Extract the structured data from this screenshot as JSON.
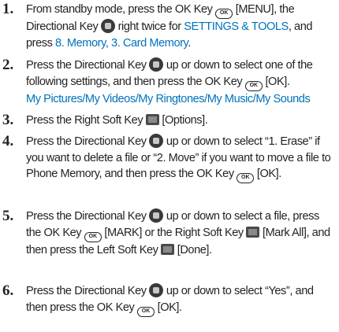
{
  "steps": [
    {
      "number": "1",
      "t1": "From standby mode, press the OK Key",
      "t2": "[MENU], the Directional Key",
      "t3": "right twice for",
      "h1": "SETTINGS & TOOLS",
      "t4": ", and press",
      "h2": "8. Memory, 3. Card Memory",
      "t5": "."
    },
    {
      "number": "2",
      "t1": "Press the Directional Key",
      "t2": "up or down to select one of the following settings, and then press the OK Key",
      "t3": "[OK].",
      "h1": "My Pictures/My Videos/My Ringtones/My Music/My Sounds"
    },
    {
      "number": "3",
      "t1": "Press the Right Soft Key",
      "t2": "[Options]."
    },
    {
      "number": "4",
      "t1": "Press the Directional Key",
      "t2": "up or down to select “1. Erase” if you want to delete a file or “2. Move” if you want to move a file to Phone Memory, and then press the OK Key",
      "t3": "[OK]."
    },
    {
      "number": "5",
      "t1": "Press the Directional Key",
      "t2": "up or down to select a file, press the OK Key",
      "t3": "[MARK] or the Right Soft Key",
      "t4": "[Mark All], and then press the Left Soft Key",
      "t5": "[Done]."
    },
    {
      "number": "6",
      "t1": "Press the Directional Key",
      "t2": "up or down to select “Yes”, and then press the OK Key",
      "t3": "[OK]."
    }
  ],
  "icons": {
    "ok_key_label": "OK",
    "ok_key": "ok-key-icon",
    "directional_key": "directional-key-icon",
    "right_soft_key": "right-soft-key-icon",
    "left_soft_key": "left-soft-key-icon"
  },
  "colors": {
    "text": "#231f20",
    "highlight": "#0072bc"
  }
}
